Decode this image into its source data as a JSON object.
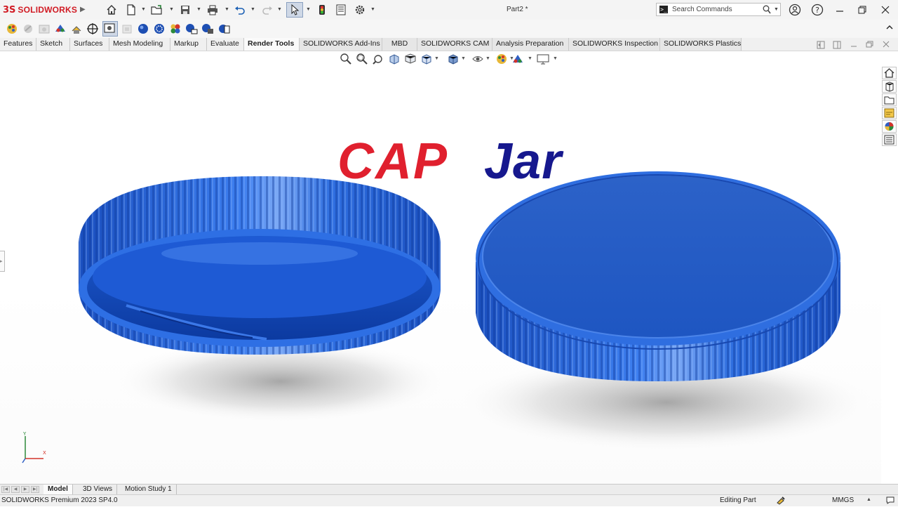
{
  "app": {
    "logo_mark": "3S",
    "logo_text": "SOLIDWORKS",
    "document_title": "Part2 *",
    "brand_color": "#d11b24"
  },
  "quick_access": {
    "icons": [
      "home-icon",
      "new-document-icon",
      "open-folder-icon",
      "save-icon",
      "print-icon",
      "undo-icon",
      "redo-icon",
      "select-pointer-icon",
      "rebuild-traffic-light-icon",
      "file-properties-icon",
      "options-gear-icon"
    ]
  },
  "search": {
    "placeholder": "Search Commands",
    "terminal_glyph": ">_"
  },
  "window_controls": [
    "user-account-icon",
    "help-icon",
    "minimize-icon",
    "restore-icon",
    "close-icon"
  ],
  "command_icons": [
    "appearance-icon",
    "decals-icon",
    "scene-icon",
    "lights-icon",
    "move-triad-icon",
    "render-region-icon",
    "schedule-icon",
    "preview-window-icon",
    "final-render-icon",
    "options-render-icon",
    "recall-render-icon",
    "render-tools-settings-icon"
  ],
  "tabs": [
    {
      "label": "Features",
      "active": false
    },
    {
      "label": "Sketch",
      "active": false
    },
    {
      "label": "Surfaces",
      "active": false
    },
    {
      "label": "Mesh Modeling",
      "active": false
    },
    {
      "label": "Markup",
      "active": false
    },
    {
      "label": "Evaluate",
      "active": false
    },
    {
      "label": "Render Tools",
      "active": true
    },
    {
      "label": "SOLIDWORKS Add-Ins",
      "active": false
    },
    {
      "label": "MBD",
      "active": false
    },
    {
      "label": "SOLIDWORKS CAM",
      "active": false
    },
    {
      "label": "Analysis Preparation",
      "active": false
    },
    {
      "label": "SOLIDWORKS Inspection",
      "active": false
    },
    {
      "label": "SOLIDWORKS Plastics",
      "active": false
    }
  ],
  "heads_up": [
    "zoom-to-fit-icon",
    "zoom-area-icon",
    "previous-view-icon",
    "section-view-icon",
    "dynamic-annotation-icon",
    "view-orientation-icon",
    "display-style-icon",
    "hide-show-icon",
    "edit-appearance-icon",
    "apply-scene-icon",
    "view-settings-icon"
  ],
  "task_pane": [
    "solidworks-resources-icon",
    "design-library-icon",
    "file-explorer-icon",
    "view-palette-icon",
    "appearances-scenes-icon",
    "custom-properties-icon"
  ],
  "viewport": {
    "title_word1": "CAP",
    "title_word2": "Jar",
    "title_color1": "#e0202e",
    "title_color2": "#16188e",
    "model_color": "#1f5fd6",
    "triad": {
      "x": "X",
      "y": "Y"
    }
  },
  "bottom_tabs": [
    {
      "label": "Model",
      "active": true
    },
    {
      "label": "3D Views",
      "active": false
    },
    {
      "label": "Motion Study 1",
      "active": false
    }
  ],
  "status": {
    "product": "SOLIDWORKS Premium 2023 SP4.0",
    "mode": "Editing Part",
    "units": "MMGS"
  }
}
